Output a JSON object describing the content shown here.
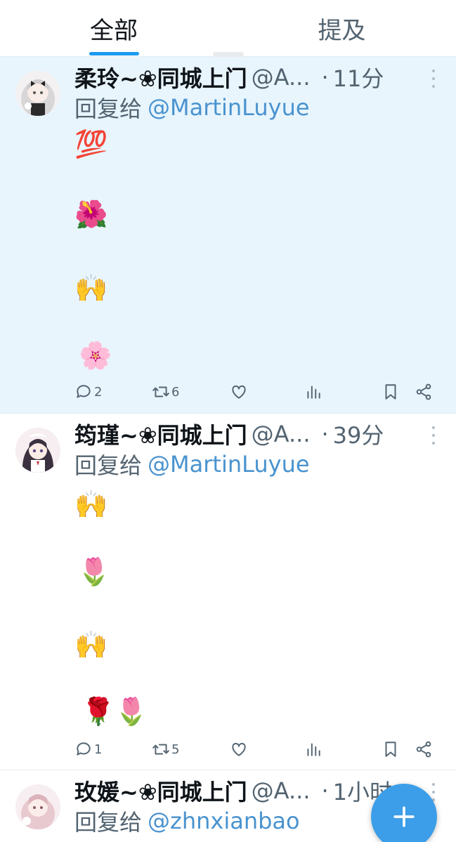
{
  "tabs": [
    {
      "label": "全部",
      "active": true
    },
    {
      "label": "提及",
      "active": false
    }
  ],
  "tweets": [
    {
      "name": "柔玲~❀同城上门",
      "handle": "@A...",
      "separator": "·",
      "time": "11分",
      "reply_prefix": "回复给",
      "reply_to": "@MartinLuyue",
      "lines": [
        "💯",
        "🌺",
        "🙌",
        "🌸"
      ],
      "replies": "2",
      "retweets": "6",
      "likes": "",
      "highlighted": true
    },
    {
      "name": "筠瑾~❀同城上门",
      "handle": "@A...",
      "separator": "·",
      "time": "39分",
      "reply_prefix": "回复给",
      "reply_to": "@MartinLuyue",
      "lines": [
        "🙌",
        "🌷",
        "🙌",
        "🌹🌷"
      ],
      "replies": "1",
      "retweets": "5",
      "likes": "",
      "highlighted": false
    },
    {
      "name": "玫媛~❀同城上门",
      "handle": "@A...",
      "separator": "·",
      "time": "1小时",
      "reply_prefix": "回复给",
      "reply_to": "@zhnxianbao",
      "lines": [],
      "highlighted": false
    }
  ],
  "icons": {
    "reply": "comment-icon",
    "retweet": "retweet-icon",
    "like": "heart-icon",
    "views": "views-icon",
    "bookmark": "bookmark-icon",
    "share": "share-icon",
    "compose": "plus-icon"
  },
  "colors": {
    "accent": "#1d9bf0",
    "highlight_bg": "#e8f5fd",
    "mention": "#4a93cf",
    "fab": "#3c9ee8",
    "muted": "#536471"
  }
}
